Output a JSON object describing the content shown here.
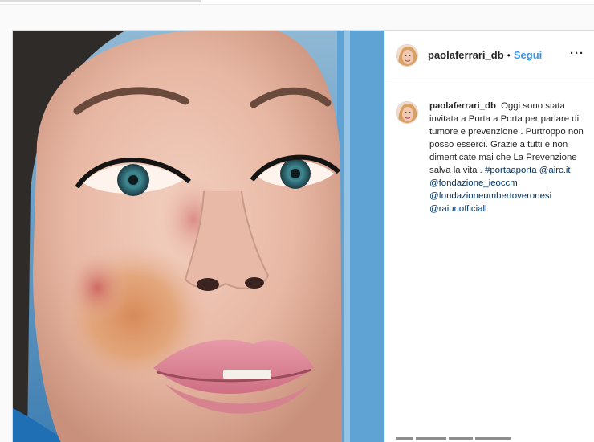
{
  "post": {
    "username": "paolaferrari_db",
    "separator": "•",
    "follow_label": "Segui",
    "more_label": "···",
    "caption": {
      "username": "paolaferrari_db",
      "text": "Oggi sono stata invitata a Porta a Porta per parlare di tumore e prevenzione . Purtroppo non posso esserci. Grazie a tutti e non dimenticate mai che La Prevenzione salva la vita .",
      "hashtag": "#portaaporta",
      "mentions": [
        "@airc.it",
        "@fondazione_ieoccm",
        "@fondazioneumbertoveronesi",
        "@raiunofficiall"
      ]
    }
  },
  "icons": {
    "avatar": "profile-photo",
    "more": "ellipsis-icon"
  },
  "colors": {
    "link_blue": "#3897f0",
    "mention_blue": "#003569",
    "border": "#dbdbdb"
  }
}
